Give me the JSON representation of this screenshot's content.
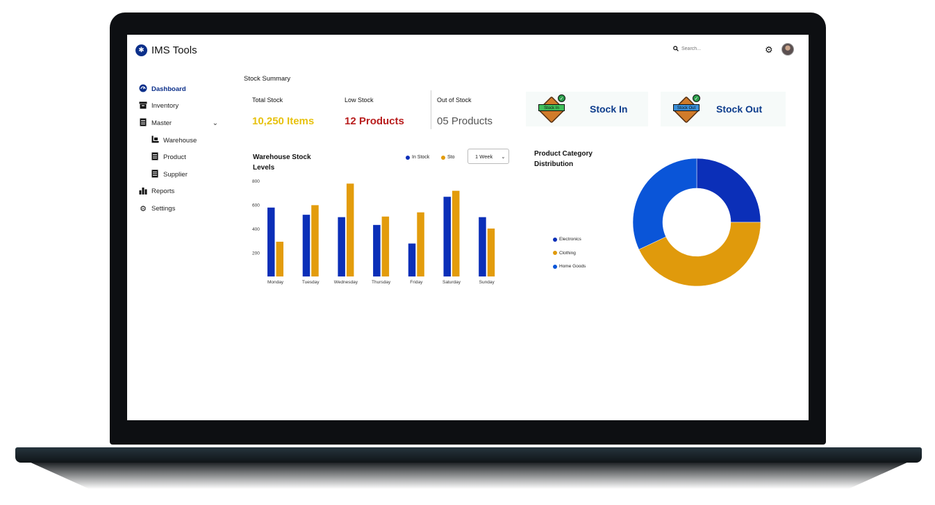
{
  "app": {
    "title": "IMS Tools"
  },
  "header": {
    "search_placeholder": "Search..."
  },
  "sidebar": {
    "items": [
      {
        "label": "Dashboard",
        "icon": "dashboard-icon",
        "active": true
      },
      {
        "label": "Inventory",
        "icon": "inventory-icon"
      },
      {
        "label": "Master",
        "icon": "master-icon",
        "expanded": true
      },
      {
        "label": "Warehouse",
        "icon": "warehouse-icon",
        "sub": true
      },
      {
        "label": "Product",
        "icon": "product-icon",
        "sub": true
      },
      {
        "label": "Supplier",
        "icon": "supplier-icon",
        "sub": true
      },
      {
        "label": "Reports",
        "icon": "reports-icon"
      },
      {
        "label": "Settings",
        "icon": "settings-icon"
      }
    ]
  },
  "summary": {
    "title": "Stock Summary",
    "total_label": "Total Stock",
    "total_value": "10,250 Items",
    "low_label": "Low Stock",
    "low_value": "12 Products",
    "out_label": "Out of Stock",
    "out_value": "05 Products",
    "stock_in_label": "Stock In",
    "stock_in_badge": "Stock In",
    "stock_out_label": "Stock Out",
    "stock_out_badge": "Stock Out"
  },
  "colors": {
    "in_stock": "#0b2fb8",
    "stock_out": "#e39c0c",
    "total_value": "#e7c10e",
    "low_value": "#b81d1d",
    "out_value": "#555555",
    "electronics": "#0b2fb8",
    "clothing": "#e09a0c",
    "home_goods": "#0a55d8"
  },
  "warehouse_chart": {
    "title": "Warehouse Stock Levels",
    "legend_in": "In Stock",
    "legend_out": "Sto",
    "period": "1 Week"
  },
  "category_chart": {
    "title": "Product Category Distribution"
  },
  "chart_data": [
    {
      "type": "bar",
      "title": "Warehouse Stock Levels",
      "categories": [
        "Monday",
        "Tuesday",
        "Wednesday",
        "Thursday",
        "Friday",
        "Saturday",
        "Sunday"
      ],
      "series": [
        {
          "name": "In Stock",
          "values": [
            575,
            515,
            495,
            430,
            275,
            665,
            495
          ]
        },
        {
          "name": "Sto",
          "values": [
            290,
            595,
            775,
            500,
            535,
            715,
            400
          ]
        }
      ],
      "yticks": [
        200,
        400,
        600,
        800
      ],
      "ylim": [
        0,
        800
      ],
      "grid": false,
      "legend": "top-right"
    },
    {
      "type": "pie",
      "title": "Product Category Distribution",
      "labels": [
        "Electronics",
        "Clothing",
        "Home Goods"
      ],
      "values": [
        25,
        43,
        32
      ],
      "donut": true,
      "legend": "left"
    }
  ]
}
